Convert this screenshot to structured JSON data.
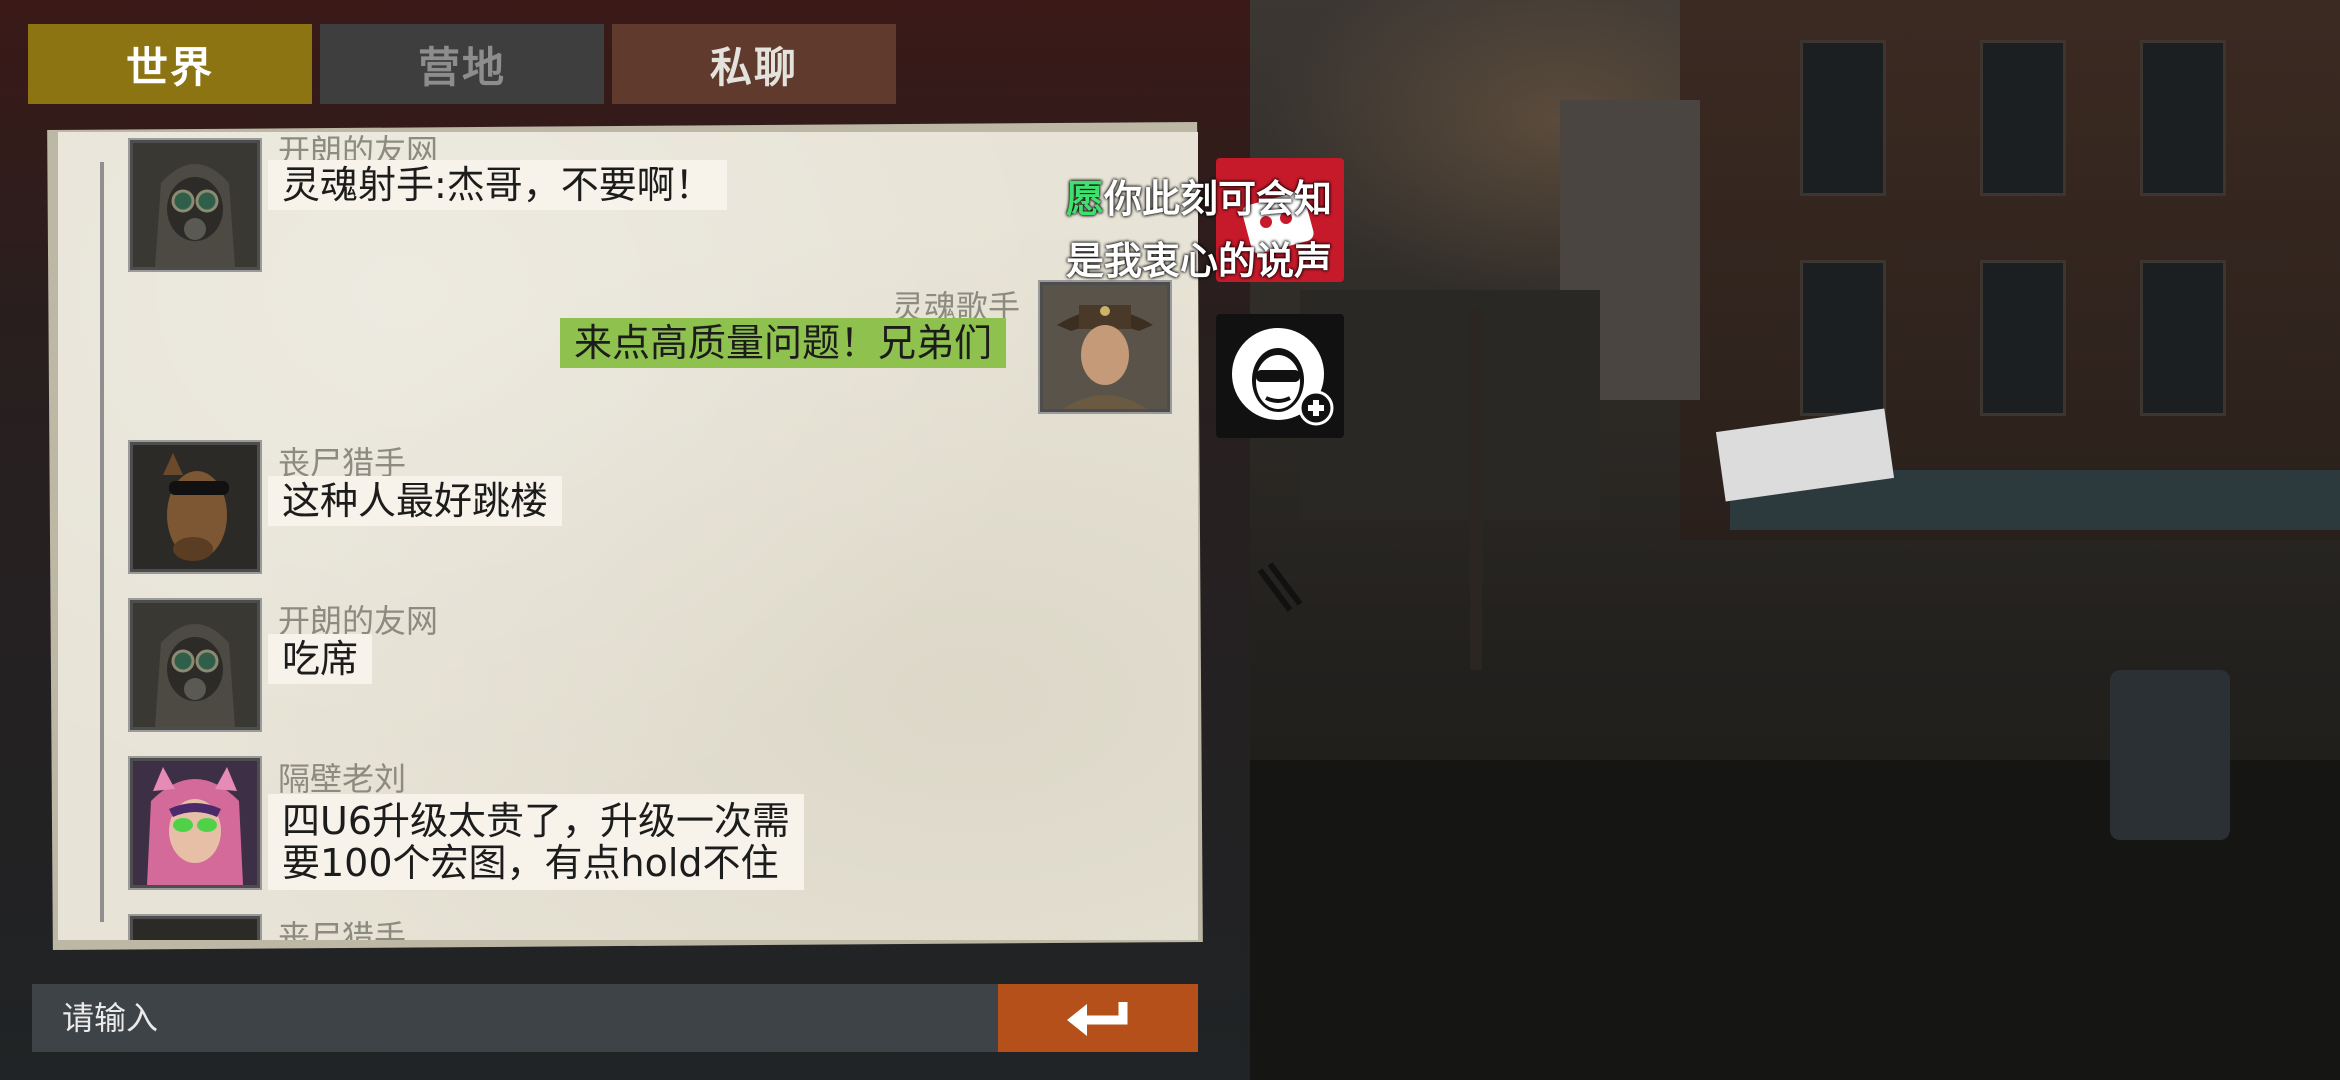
{
  "tabs": [
    {
      "label": "世界",
      "active": true
    },
    {
      "label": "营地",
      "active": false
    },
    {
      "label": "私聊",
      "active": false
    }
  ],
  "messages": [
    {
      "sender": "开朗的友网",
      "text": "灵魂射手:杰哥，不要啊！",
      "avatar": "gas-mask-avatar",
      "side": "left"
    },
    {
      "sender": "灵魂歌手",
      "text": "来点高质量问题！兄弟们",
      "avatar": "sheriff-avatar",
      "side": "right"
    },
    {
      "sender": "丧尸猎手",
      "text": "这种人最好跳楼",
      "avatar": "horse-mask-avatar",
      "side": "left"
    },
    {
      "sender": "开朗的友网",
      "text": "吃席",
      "avatar": "gas-mask-avatar",
      "side": "left"
    },
    {
      "sender": "隔壁老刘",
      "text_lines": [
        "四U6升级太贵了，升级一次需",
        "要100个宏图，有点hold不住"
      ],
      "avatar": "pink-hood-avatar",
      "side": "left"
    },
    {
      "sender": "丧尸猎手",
      "avatar": "horse-mask-avatar",
      "side": "left",
      "partially_visible": true
    }
  ],
  "input": {
    "placeholder": "请输入"
  },
  "send_icon": "enter-arrow-icon",
  "promo": {
    "highlight": "愿",
    "line1_rest": "你此刻可会知",
    "line2": "是我衷心的说声"
  },
  "add_friend_icon": "sunglasses-face-plus-icon",
  "colors": {
    "tab_active": "#8d7412",
    "tab_inactive": "#3e3e3e",
    "tab_private": "#613a2e",
    "own_bubble": "#8ec14e",
    "send_button": "#b5501a",
    "highlight": "#3fe06e"
  }
}
